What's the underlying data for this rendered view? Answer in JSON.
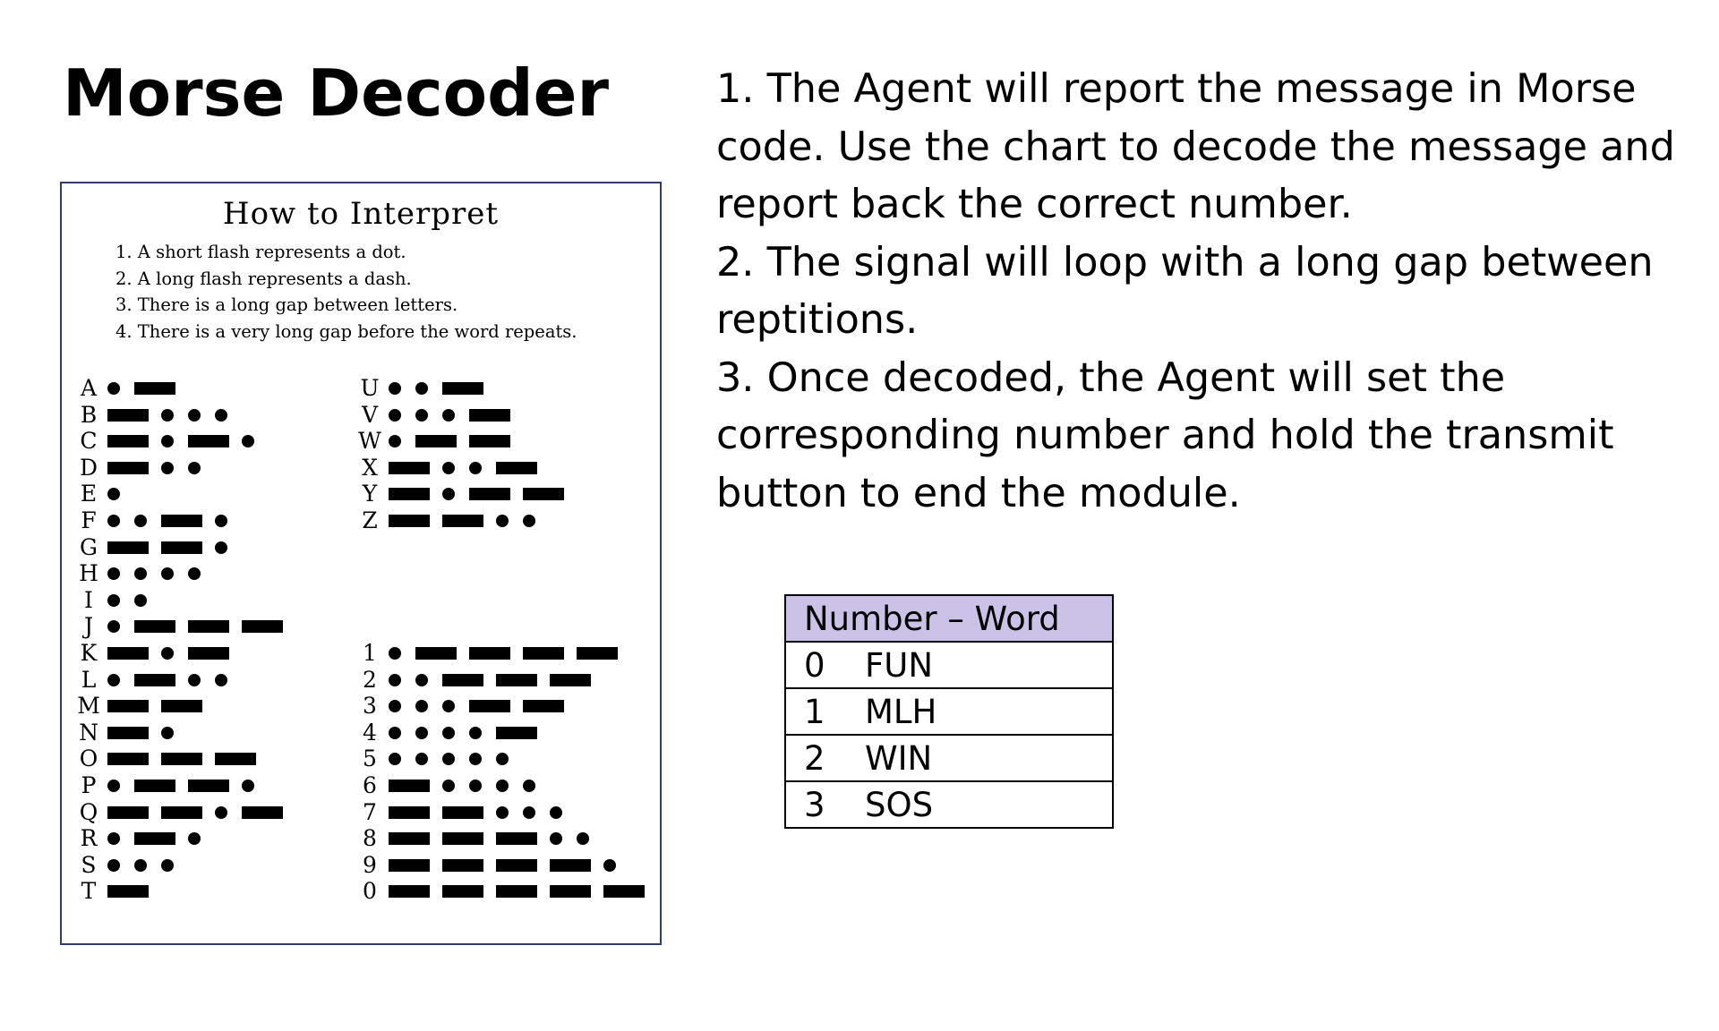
{
  "title": "Morse Decoder",
  "chart": {
    "heading": "How to Interpret",
    "rules": [
      "1. A short flash represents a dot.",
      "2. A long flash represents a dash.",
      "3. There is a long gap between letters.",
      "4. There is a very long gap before the word repeats."
    ],
    "letters_left": [
      {
        "char": "A",
        "code": ".-"
      },
      {
        "char": "B",
        "code": "-..."
      },
      {
        "char": "C",
        "code": "-.-."
      },
      {
        "char": "D",
        "code": "-.."
      },
      {
        "char": "E",
        "code": "."
      },
      {
        "char": "F",
        "code": "..-."
      },
      {
        "char": "G",
        "code": "--."
      },
      {
        "char": "H",
        "code": "...."
      },
      {
        "char": "I",
        "code": ".."
      },
      {
        "char": "J",
        "code": ".---"
      },
      {
        "char": "K",
        "code": "-.-"
      },
      {
        "char": "L",
        "code": ".-.."
      },
      {
        "char": "M",
        "code": "--"
      },
      {
        "char": "N",
        "code": "-."
      },
      {
        "char": "O",
        "code": "---"
      },
      {
        "char": "P",
        "code": ".--."
      },
      {
        "char": "Q",
        "code": "--.-"
      },
      {
        "char": "R",
        "code": ".-."
      },
      {
        "char": "S",
        "code": "..."
      },
      {
        "char": "T",
        "code": "-"
      }
    ],
    "letters_right": [
      {
        "char": "U",
        "code": "..-"
      },
      {
        "char": "V",
        "code": "...-"
      },
      {
        "char": "W",
        "code": ".--"
      },
      {
        "char": "X",
        "code": "-..-"
      },
      {
        "char": "Y",
        "code": "-.--"
      },
      {
        "char": "Z",
        "code": "--.."
      }
    ],
    "digits": [
      {
        "char": "1",
        "code": ".----"
      },
      {
        "char": "2",
        "code": "..---"
      },
      {
        "char": "3",
        "code": "...--"
      },
      {
        "char": "4",
        "code": "....-"
      },
      {
        "char": "5",
        "code": "....."
      },
      {
        "char": "6",
        "code": "-...."
      },
      {
        "char": "7",
        "code": "--..."
      },
      {
        "char": "8",
        "code": "---.."
      },
      {
        "char": "9",
        "code": "----."
      },
      {
        "char": "0",
        "code": "-----"
      }
    ]
  },
  "instructions": [
    "1. The Agent will report the message in Morse code. Use the chart to decode the message and report back the correct number.",
    "2. The signal will loop with a long gap between reptitions.",
    "3. Once decoded, the Agent will set the corresponding number and hold the transmit button to end the module."
  ],
  "word_table": {
    "header": "Number – Word",
    "rows": [
      {
        "number": "0",
        "word": "FUN"
      },
      {
        "number": "1",
        "word": "MLH"
      },
      {
        "number": "2",
        "word": "WIN"
      },
      {
        "number": "3",
        "word": "SOS"
      }
    ]
  }
}
